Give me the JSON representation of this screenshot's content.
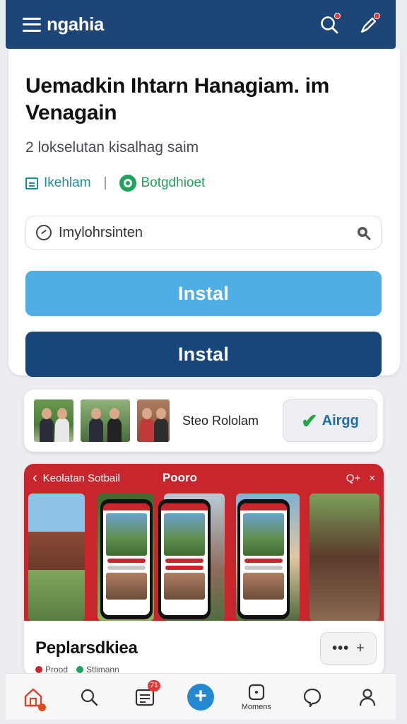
{
  "header": {
    "brand": "ngahia"
  },
  "main": {
    "title": "Uemadkin Ihtarn Hanagiam. im Venagain",
    "subtitle": "2 lokselutan kisalhag saim",
    "meta_left": "Ikehlam",
    "meta_sep": "|",
    "meta_right": "Botgdhioet",
    "search_placeholder": "Imylohrsinten",
    "install_primary": "Instal",
    "install_secondary": "Instal"
  },
  "friends": {
    "label": "Steo Rololam",
    "agree_label": "Airgg"
  },
  "showcase": {
    "header_left": "Keolatan Sotbail",
    "header_center": "Pooro",
    "header_right": "Q+",
    "close": "×",
    "title": "Peplarsdkiea",
    "more_plus": "+",
    "more_dots": "•••",
    "sub_left": "Prood",
    "sub_right": "Stlimann"
  },
  "nav": {
    "badge": "71",
    "moments_label": "Momens"
  },
  "colors": {
    "header_bg": "#1d4576",
    "install_light": "#4faee3",
    "install_dark": "#17477a",
    "showcase_red": "#c8252d",
    "accent_green": "#1fa35a"
  }
}
